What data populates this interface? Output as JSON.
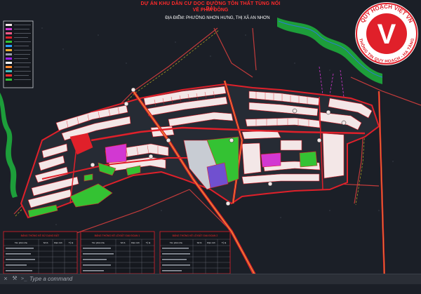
{
  "header": {
    "title_line1": "DỰ ÁN KHU DÂN CƯ DỌC ĐƯỜNG TÔN THẤT TÙNG NỐI DÀI",
    "title_line2": "VỀ PHÍA ĐÔNG",
    "location": "ĐỊA ĐIỂM: PHƯỜNG NHƠN HƯNG, THỊ XÃ AN NHƠN"
  },
  "watermark": {
    "top_text": "QUY HOẠCH VIỆT VN",
    "bottom_text": "THÔNG TIN QUY HOẠCH - HẠ TẦNG",
    "letter": "V"
  },
  "tables": {
    "table1_title": "BẢNG THỐNG KÊ SỬ DỤNG ĐẤT",
    "table2_title": "BẢNG THỐNG KÊ LÔ ĐẤT GIAI ĐOẠN 1",
    "table3_title": "BẢNG THỐNG KÊ LÔ ĐẤT GIAI ĐOẠN 2",
    "col_name": "Tên phân khu",
    "col_lots": "Số lô",
    "col_area": "Diện tích",
    "col_pct": "Tỷ lệ"
  },
  "command_line": {
    "close_icon": "×",
    "prompt_icon": ">_",
    "placeholder": "Type a command"
  },
  "colors": {
    "background": "#1b1f27",
    "road_red": "#e0202a",
    "residential": "#f3e7e7",
    "green": "#34c233",
    "magenta": "#d238d2",
    "river": "#1d9e3a",
    "title_red": "#ff2a2a"
  }
}
